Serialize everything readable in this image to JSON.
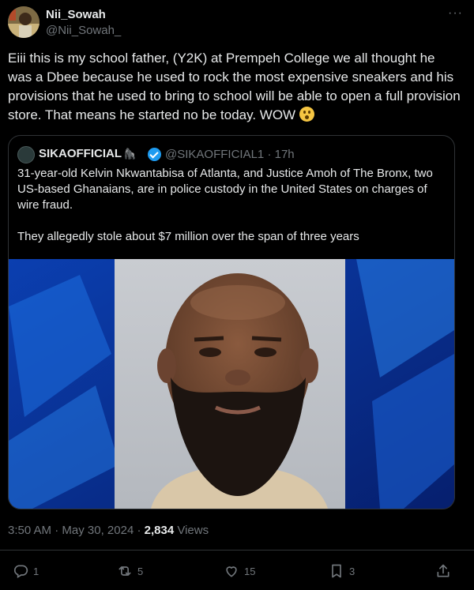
{
  "author": {
    "name": "Nii_Sowah",
    "handle": "@Nii_Sowah_",
    "avatar_icon": "profile-photo"
  },
  "post": {
    "text": "Eiii this is my school father, (Y2K) at Prempeh College we all thought he was a Dbee because he used to rock the most expensive sneakers and his provisions that he used to bring to school will be able to open a full provision store. That means he started no be today. WOW",
    "emoji": "astonished-face-emoji"
  },
  "quote": {
    "name": "SIKAOFFICIAL",
    "name_emoji": "🦍",
    "handle": "@SIKAOFFICIAL1",
    "time": "17h",
    "separator": "·",
    "paragraph1": "31-year-old Kelvin Nkwantabisa of Atlanta, and Justice Amoh of The Bronx, two US-based Ghanaians, are in police custody in the United States on charges of wire fraud.",
    "paragraph2": "They allegedly stole about $7 million over the span of three years"
  },
  "meta": {
    "time": "3:50 AM",
    "date": "May 30, 2024",
    "views_count": "2,834",
    "views_label": "Views",
    "sep": "·"
  },
  "actions": {
    "replies": "1",
    "reposts": "5",
    "likes": "15",
    "bookmarks": "3"
  },
  "colors": {
    "background": "#000000",
    "text": "#e7e9ea",
    "muted": "#71767b",
    "border": "#2f3336",
    "verified": "#1d9bf0"
  }
}
